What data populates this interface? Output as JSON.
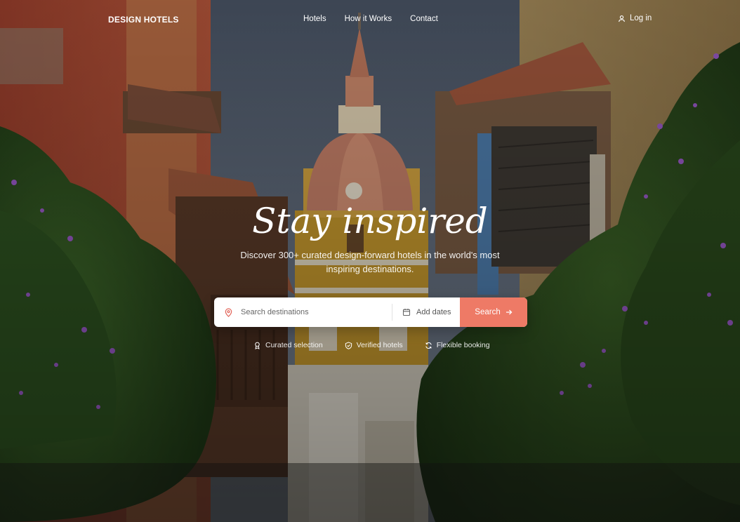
{
  "brand": {
    "name": "DESIGN HOTELS"
  },
  "nav": {
    "links": [
      {
        "label": "Hotels"
      },
      {
        "label": "How it Works"
      },
      {
        "label": "Contact"
      }
    ],
    "login_label": "Log in",
    "login_icon": "user-icon"
  },
  "hero": {
    "headline": "Stay inspired",
    "subtitle": "Discover 300+ curated design-forward hotels in the world's most inspiring destinations."
  },
  "search": {
    "destination_placeholder": "Search destinations",
    "destination_value": "",
    "dates_label": "Add dates",
    "button_label": "Search",
    "button_color": "#ee7a66",
    "icons": [
      "map-pin-icon",
      "calendar-icon",
      "arrow-right-icon"
    ]
  },
  "features": [
    {
      "label": "Curated selection",
      "icon": "award-icon"
    },
    {
      "label": "Verified hotels",
      "icon": "shield-check-icon"
    },
    {
      "label": "Flexible booking",
      "icon": "refresh-icon"
    }
  ]
}
